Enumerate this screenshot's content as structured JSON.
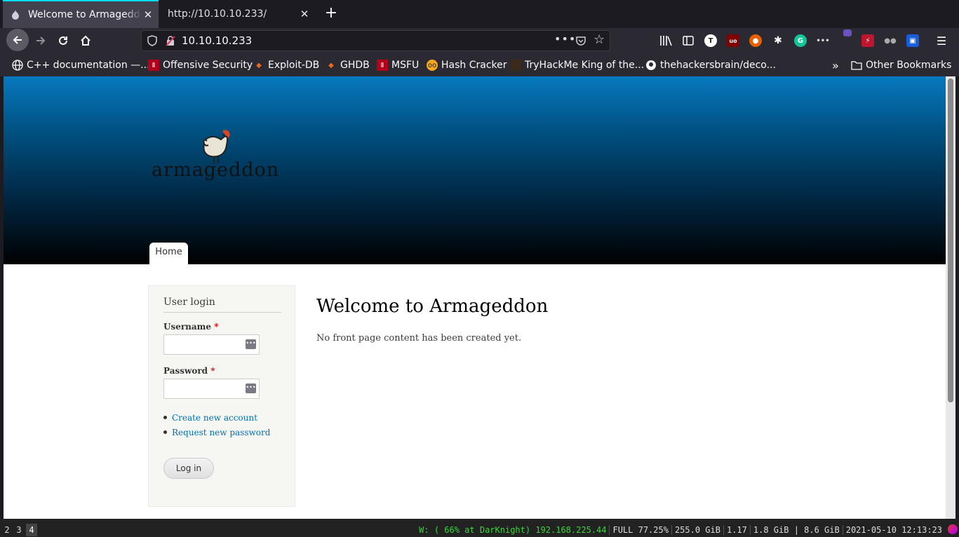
{
  "browser": {
    "tabs": [
      {
        "title": "Welcome to Armageddon",
        "favicon": "drupal-icon"
      },
      {
        "title": "http://10.10.10.233/",
        "favicon": ""
      }
    ],
    "url": "10.10.10.233",
    "extension_badge": "5",
    "bookmarks": [
      {
        "label": "C++ documentation —...",
        "icon": "globe-icon"
      },
      {
        "label": "Offensive Security",
        "icon": "offsec-icon"
      },
      {
        "label": "Exploit-DB",
        "icon": "exploitdb-icon"
      },
      {
        "label": "GHDB",
        "icon": "ghdb-icon"
      },
      {
        "label": "MSFU",
        "icon": "msfu-icon"
      },
      {
        "label": "Hash Cracker",
        "icon": "hashcracker-icon"
      },
      {
        "label": "TryHackMe King of the...",
        "icon": "tryhackme-icon"
      },
      {
        "label": "thehackersbrain/deco...",
        "icon": "github-icon"
      }
    ],
    "other_bookmarks": "Other Bookmarks"
  },
  "site": {
    "logo_text": "armageddon",
    "nav_home": "Home",
    "login": {
      "title": "User login",
      "username_label": "Username",
      "password_label": "Password",
      "required_mark": "*",
      "create_account": "Create new account",
      "request_password": "Request new password",
      "submit": "Log in"
    },
    "main": {
      "title": "Welcome to Armageddon",
      "text": "No front page content has been created yet."
    }
  },
  "statusbar": {
    "workspaces": [
      "2",
      "3",
      "4"
    ],
    "current_workspace": "4",
    "wifi": "W: ( 66% at DarKnight) 192.168.225.44",
    "battery": "FULL 77.25%",
    "disk": "255.0 GiB",
    "load": "1.17",
    "memory": "1.8 GiB | 8.6 GiB",
    "datetime": "2021-05-10 12:13:23"
  },
  "colors": {
    "header_top": "#0779bf",
    "header_bottom": "#000000",
    "link": "#0071b3",
    "active_tab_accent": "#00ddff"
  }
}
